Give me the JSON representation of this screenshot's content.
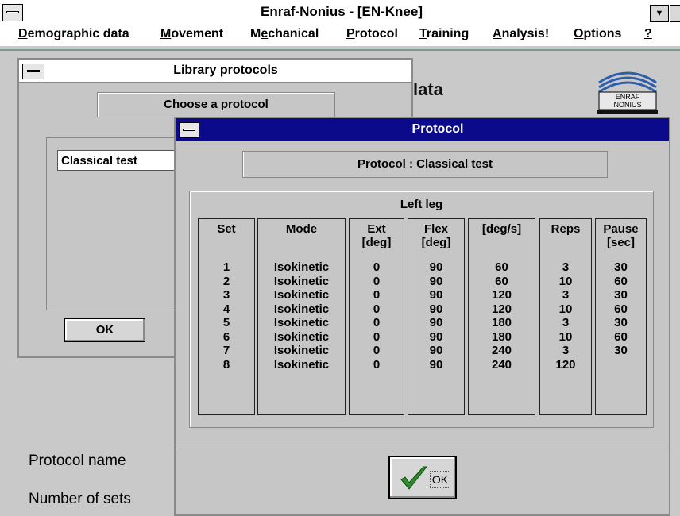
{
  "window": {
    "title": "Enraf-Nonius - [EN-Knee]"
  },
  "menu": [
    {
      "pre": "",
      "u": "D",
      "post": "emographic data"
    },
    {
      "pre": "",
      "u": "M",
      "post": "ovement"
    },
    {
      "pre": "M",
      "u": "e",
      "post": "chanical"
    },
    {
      "pre": "",
      "u": "P",
      "post": "rotocol"
    },
    {
      "pre": "",
      "u": "T",
      "post": "raining"
    },
    {
      "pre": "",
      "u": "A",
      "post": "nalysis!"
    },
    {
      "pre": "",
      "u": "O",
      "post": "ptions"
    },
    {
      "pre": "",
      "u": "?",
      "post": ""
    }
  ],
  "background": {
    "heading_fragment": "lata",
    "logo_text": [
      "ENRAF",
      "NONIUS"
    ],
    "protocol_name_label": "Protocol name",
    "number_of_sets_label": "Number of sets"
  },
  "library": {
    "title": "Library protocols",
    "choose_label": "Choose a protocol",
    "selected": "Classical test",
    "ok_label": "OK"
  },
  "protocol": {
    "title": "Protocol",
    "label": "Protocol :   Classical test",
    "group_title": "Left leg",
    "columns": [
      {
        "header": "Set",
        "values": [
          "1",
          "2",
          "3",
          "4",
          "5",
          "6",
          "7",
          "8"
        ]
      },
      {
        "header": "Mode",
        "values": [
          "Isokinetic",
          "Isokinetic",
          "Isokinetic",
          "Isokinetic",
          "Isokinetic",
          "Isokinetic",
          "Isokinetic",
          "Isokinetic"
        ]
      },
      {
        "header": "Ext\n[deg]",
        "values": [
          "0",
          "0",
          "0",
          "0",
          "0",
          "0",
          "0",
          "0"
        ]
      },
      {
        "header": "Flex\n[deg]",
        "values": [
          "90",
          "90",
          "90",
          "90",
          "90",
          "90",
          "90",
          "90"
        ]
      },
      {
        "header": "[deg/s]",
        "values": [
          "60",
          "60",
          "120",
          "120",
          "180",
          "180",
          "240",
          "240"
        ]
      },
      {
        "header": "Reps",
        "values": [
          "3",
          "10",
          "3",
          "10",
          "3",
          "10",
          "3",
          "120"
        ]
      },
      {
        "header": "Pause\n[sec]",
        "values": [
          "30",
          "60",
          "30",
          "60",
          "30",
          "60",
          "30"
        ]
      }
    ],
    "ok_label": "OK"
  },
  "colors": {
    "title_active": "#0a0a8a",
    "background": "#c9c9c9",
    "check": "#2e8b2e"
  }
}
